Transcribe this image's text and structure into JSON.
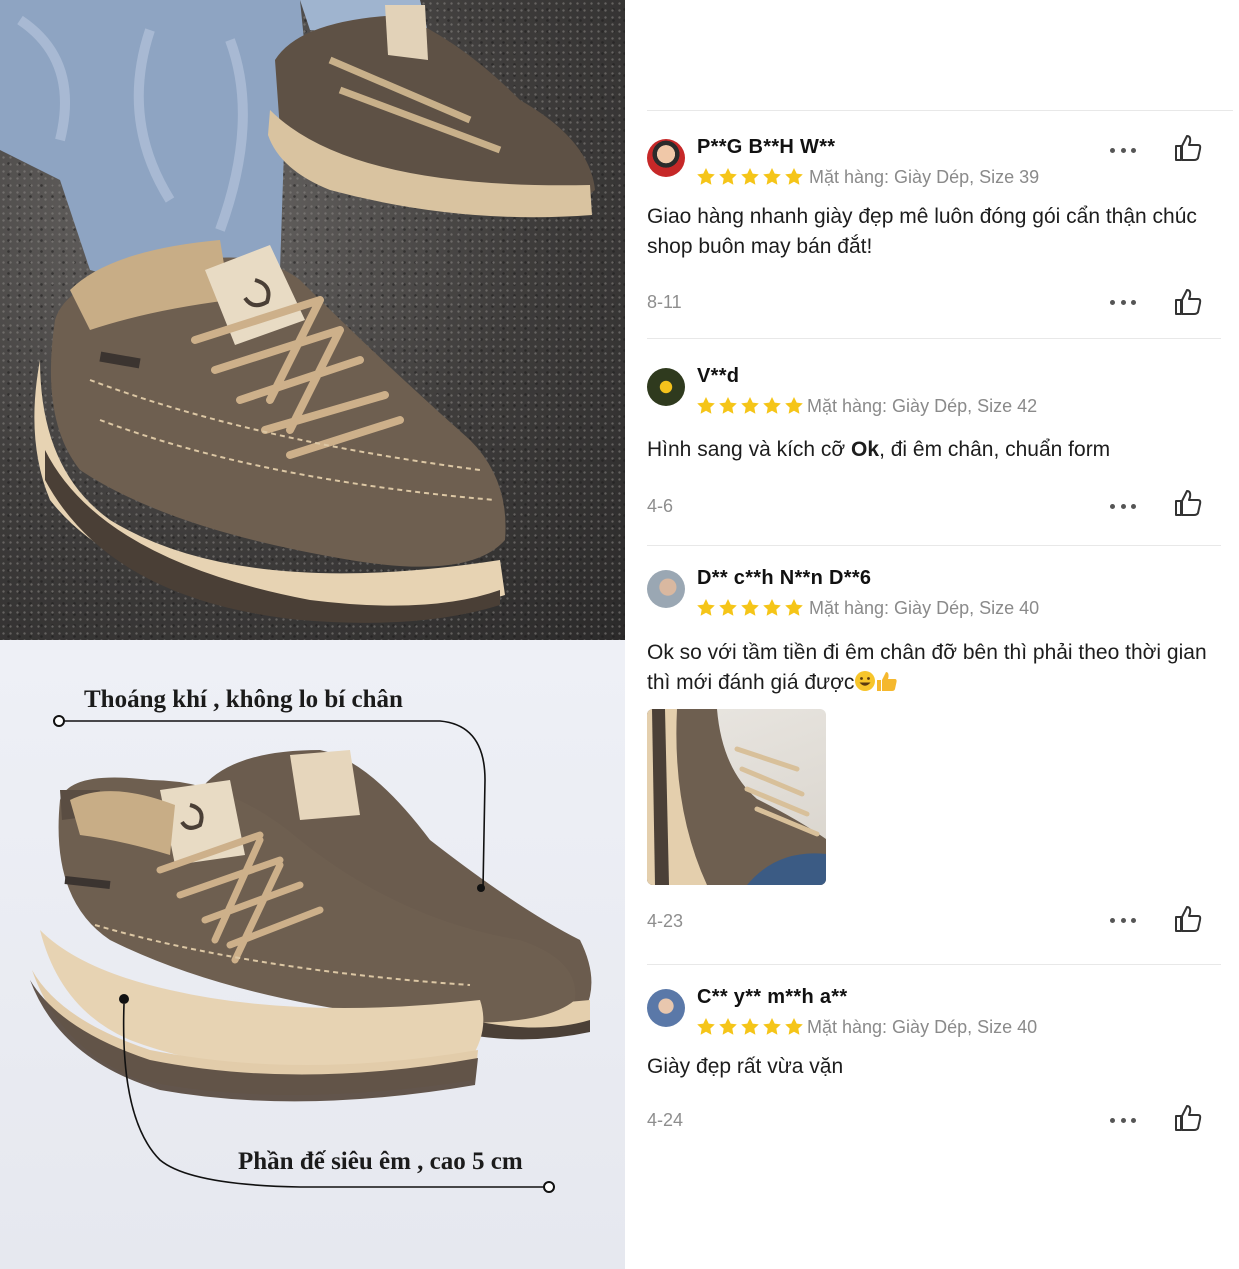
{
  "product_images": {
    "feature_breathable": "Thoáng khí , không lo bí chân",
    "feature_sole": "Phần đế siêu êm , cao 5 cm"
  },
  "colors": {
    "star": "#f5c518",
    "shoe_upper": "#6e5f50",
    "shoe_sole": "#e7d3b3"
  },
  "reviews": [
    {
      "user": "P**G B**H W**",
      "rating": 5,
      "variant": "Mặt hàng: Giày Dép, Size 39",
      "text": "Giao hàng nhanh giày đẹp mê luôn đóng gói cẩn thận chúc shop buôn may bán đắt!",
      "date": "8-11",
      "has_photo": false
    },
    {
      "user": "V**d",
      "rating": 5,
      "variant": "Mặt hàng: Giày Dép, Size 42",
      "text_before": "Hình sang và kích cỡ ",
      "text_bold": "Ok",
      "text_after": ", đi êm chân, chuẩn form",
      "date": "4-6",
      "has_photo": false
    },
    {
      "user": "D** c**h N**n D**6",
      "rating": 5,
      "variant": "Mặt hàng: Giày Dép, Size 40",
      "text": "Ok so với tầm tiền đi êm chân đỡ bên thì phải theo thời gian thì mới đánh giá được",
      "emojis": [
        "grinning-face-emoji",
        "thumbs-up-emoji"
      ],
      "date": "4-23",
      "has_photo": true
    },
    {
      "user": "C** y** m**h a**",
      "rating": 5,
      "variant": "Mặt hàng: Giày Dép, Size 40",
      "text": "Giày đẹp rất vừa vặn",
      "date": "4-24",
      "has_photo": false
    }
  ],
  "icons": {
    "more": "more-options-icon",
    "like": "thumbs-up-icon",
    "star": "star-icon"
  }
}
